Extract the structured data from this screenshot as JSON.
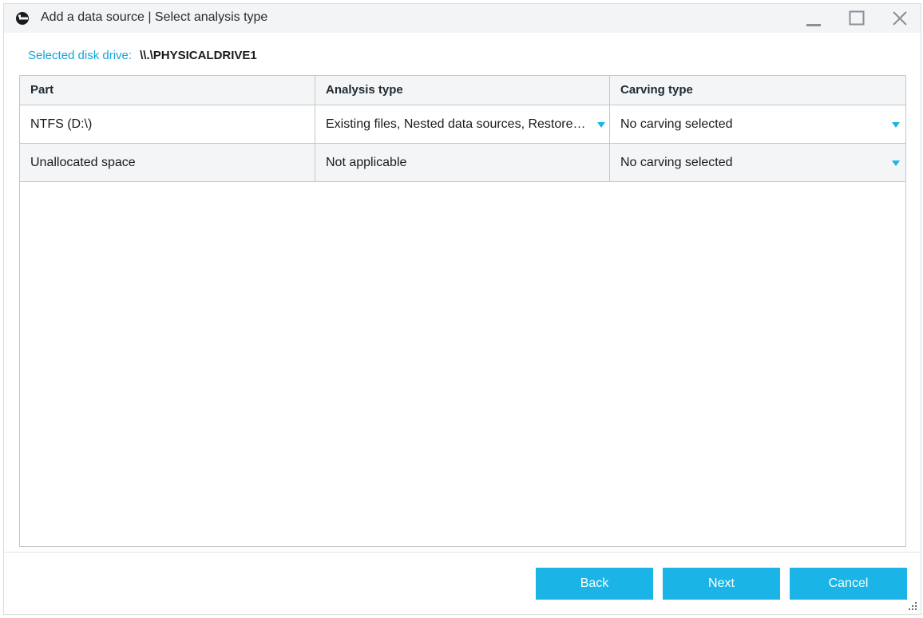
{
  "window": {
    "title": "Add a data source | Select analysis type"
  },
  "selected": {
    "label": "Selected disk drive:",
    "value": "\\\\.\\PHYSICALDRIVE1"
  },
  "table": {
    "headers": [
      "Part",
      "Analysis type",
      "Carving type"
    ],
    "rows": [
      {
        "part": "NTFS  (D:\\)",
        "analysis": "Existing files, Nested data sources, Restore…",
        "carving": "No carving selected"
      },
      {
        "part": "Unallocated space",
        "analysis": "Not applicable",
        "carving": "No carving selected"
      }
    ]
  },
  "buttons": {
    "back": "Back",
    "next": "Next",
    "cancel": "Cancel"
  },
  "colors": {
    "accent": "#1ab4e6",
    "label_blue": "#13a6d9"
  },
  "icons": {
    "app": "app-logo-icon",
    "minimize": "minimize-icon",
    "maximize": "maximize-icon",
    "close": "close-icon",
    "dropdown": "dropdown-arrow-icon",
    "resize": "resize-grip-icon"
  }
}
